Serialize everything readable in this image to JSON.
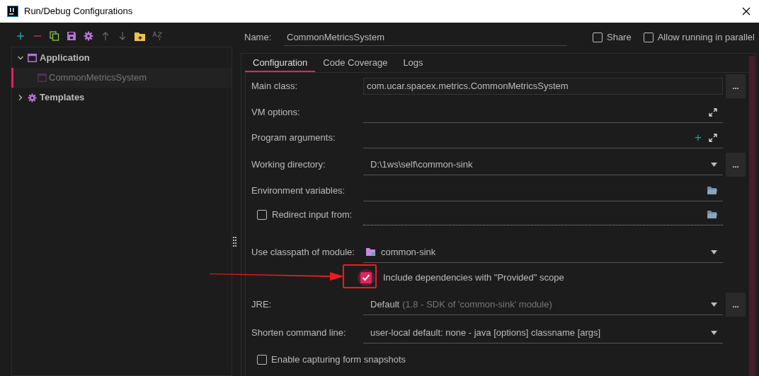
{
  "window": {
    "title": "Run/Debug Configurations"
  },
  "tree": [
    {
      "label": "Application",
      "expanded": true,
      "children": [
        {
          "label": "CommonMetricsSystem",
          "selected": true
        }
      ]
    },
    {
      "label": "Templates",
      "expanded": false
    }
  ],
  "name_field": {
    "label": "Name:",
    "value": "CommonMetricsSystem"
  },
  "options": [
    {
      "label": "Share",
      "checked": false
    },
    {
      "label": "Allow running in parallel",
      "checked": false
    }
  ],
  "tabs": [
    {
      "label": "Configuration",
      "selected": true
    },
    {
      "label": "Code Coverage",
      "selected": false
    },
    {
      "label": "Logs",
      "selected": false
    }
  ],
  "form": [
    {
      "kind": "text",
      "label": "Main class:",
      "value": "com.ucar.spacex.metrics.CommonMetricsSystem",
      "browse_button": "..."
    },
    {
      "kind": "expand",
      "label": "VM options:"
    },
    {
      "kind": "expand",
      "label": "Program arguments:",
      "add_button": "+"
    },
    {
      "kind": "combo",
      "label": "Working directory:",
      "value": "D:\\1ws\\self\\common-sink",
      "browse_button": "..."
    },
    {
      "kind": "folder",
      "label": "Environment variables:"
    },
    {
      "kind": "folder",
      "label": "Redirect input from:",
      "checked": false
    },
    {
      "kind": "module",
      "label": "Use classpath of module:",
      "value": "common-sink"
    },
    {
      "kind": "check",
      "label": "Include dependencies with \"Provided\" scope",
      "checked": true
    },
    {
      "kind": "combo",
      "label": "JRE:",
      "value": "Default",
      "hint": "(1.8 - SDK of 'common-sink' module)",
      "browse_button": "..."
    },
    {
      "kind": "combo",
      "label": "Shorten command line:",
      "value": "user-local default: none - java [options] classname [args]"
    },
    {
      "kind": "check",
      "label": "Enable capturing form snapshots",
      "checked": false
    }
  ]
}
